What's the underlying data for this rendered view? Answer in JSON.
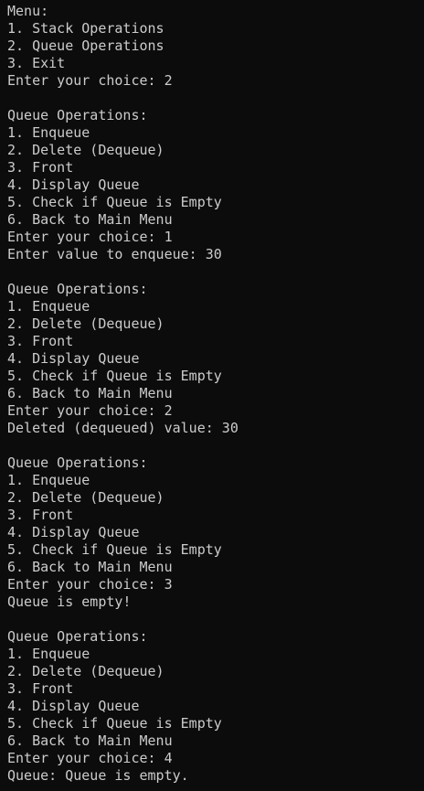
{
  "terminal": {
    "lines": [
      "Menu:",
      "1. Stack Operations",
      "2. Queue Operations",
      "3. Exit",
      "Enter your choice: 2",
      "",
      "Queue Operations:",
      "1. Enqueue",
      "2. Delete (Dequeue)",
      "3. Front",
      "4. Display Queue",
      "5. Check if Queue is Empty",
      "6. Back to Main Menu",
      "Enter your choice: 1",
      "Enter value to enqueue: 30",
      "",
      "Queue Operations:",
      "1. Enqueue",
      "2. Delete (Dequeue)",
      "3. Front",
      "4. Display Queue",
      "5. Check if Queue is Empty",
      "6. Back to Main Menu",
      "Enter your choice: 2",
      "Deleted (dequeued) value: 30",
      "",
      "Queue Operations:",
      "1. Enqueue",
      "2. Delete (Dequeue)",
      "3. Front",
      "4. Display Queue",
      "5. Check if Queue is Empty",
      "6. Back to Main Menu",
      "Enter your choice: 3",
      "Queue is empty!",
      "",
      "Queue Operations:",
      "1. Enqueue",
      "2. Delete (Dequeue)",
      "3. Front",
      "4. Display Queue",
      "5. Check if Queue is Empty",
      "6. Back to Main Menu",
      "Enter your choice: 4",
      "Queue: Queue is empty."
    ]
  },
  "colors": {
    "background": "#0c0c0c",
    "foreground": "#cccccc"
  }
}
